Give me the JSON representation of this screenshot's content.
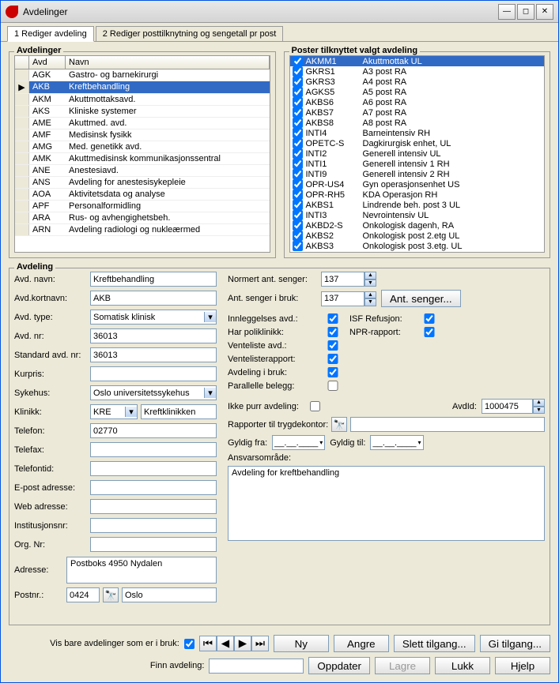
{
  "window": {
    "title": "Avdelinger"
  },
  "tabs": [
    {
      "label": "1 Rediger avdeling",
      "active": true
    },
    {
      "label": "2 Rediger posttilknytning og sengetall pr post",
      "active": false
    }
  ],
  "avdelinger": {
    "legend": "Avdelinger",
    "headers": {
      "avd": "Avd",
      "navn": "Navn"
    },
    "rows": [
      {
        "avd": "AGK",
        "navn": "Gastro- og barnekirurgi"
      },
      {
        "avd": "AKB",
        "navn": "Kreftbehandling",
        "selected": true,
        "current": true
      },
      {
        "avd": "AKM",
        "navn": "Akuttmottaksavd."
      },
      {
        "avd": "AKS",
        "navn": "Kliniske systemer"
      },
      {
        "avd": "AME",
        "navn": "Akuttmed. avd."
      },
      {
        "avd": "AMF",
        "navn": "Medisinsk fysikk"
      },
      {
        "avd": "AMG",
        "navn": "Med. genetikk avd."
      },
      {
        "avd": "AMK",
        "navn": "Akuttmedisinsk kommunikasjonssentral"
      },
      {
        "avd": "ANE",
        "navn": "Anestesiavd."
      },
      {
        "avd": "ANS",
        "navn": "Avdeling for anestesisykepleie"
      },
      {
        "avd": "AOA",
        "navn": "Aktivitetsdata og analyse"
      },
      {
        "avd": "APF",
        "navn": "Personalformidling"
      },
      {
        "avd": "ARA",
        "navn": "Rus- og avhengighetsbeh."
      },
      {
        "avd": "ARN",
        "navn": "Avdeling radiologi og nukleærmed"
      }
    ]
  },
  "poster": {
    "legend": "Poster tilknyttet valgt avdeling",
    "rows": [
      {
        "code": "AKMM1",
        "name": "Akuttmottak UL",
        "selected": true,
        "checked": true
      },
      {
        "code": "GKRS1",
        "name": "A3 post RA",
        "checked": true
      },
      {
        "code": "GKRS3",
        "name": "A4 post  RA",
        "checked": true
      },
      {
        "code": "AGKS5",
        "name": "A5 post RA",
        "checked": true
      },
      {
        "code": "AKBS6",
        "name": "A6 post RA",
        "checked": true
      },
      {
        "code": "AKBS7",
        "name": "A7 post  RA",
        "checked": true
      },
      {
        "code": "AKBS8",
        "name": "A8 post RA",
        "checked": true
      },
      {
        "code": "INTI4",
        "name": "Barneintensiv RH",
        "checked": true
      },
      {
        "code": "OPETC-S",
        "name": "Dagkirurgisk enhet, UL",
        "checked": true
      },
      {
        "code": "INTI2",
        "name": "Generell intensiv UL",
        "checked": true
      },
      {
        "code": "INTI1",
        "name": "Generell intensiv 1 RH",
        "checked": true
      },
      {
        "code": "INTI9",
        "name": "Generell intensiv 2 RH",
        "checked": true
      },
      {
        "code": "OPR-US4",
        "name": "Gyn operasjonsenhet US",
        "checked": true
      },
      {
        "code": "OPR-RH5",
        "name": "KDA Operasjon RH",
        "checked": true
      },
      {
        "code": "AKBS1",
        "name": "Lindrende beh. post 3 UL",
        "checked": true
      },
      {
        "code": "INTI3",
        "name": "Nevrointensiv UL",
        "checked": true
      },
      {
        "code": "AKBD2-S",
        "name": "Onkologisk dagenh, RA",
        "checked": true
      },
      {
        "code": "AKBS2",
        "name": "Onkologisk post 2.etg UL",
        "checked": true
      },
      {
        "code": "AKBS3",
        "name": "Onkologisk post 3.etg. UL",
        "checked": true
      }
    ]
  },
  "avdeling": {
    "legend": "Avdeling",
    "labels": {
      "navn": "Avd. navn:",
      "kortnavn": "Avd.kortnavn:",
      "type": "Avd. type:",
      "nr": "Avd. nr:",
      "stdnr": "Standard avd. nr:",
      "kurpris": "Kurpris:",
      "sykehus": "Sykehus:",
      "klinikk": "Klinikk:",
      "telefon": "Telefon:",
      "telefax": "Telefax:",
      "telefontid": "Telefontid:",
      "epost": "E-post adresse:",
      "web": "Web adresse:",
      "instnr": "Institusjonsnr:",
      "orgnr": "Org. Nr:",
      "adresse": "Adresse:",
      "postnr": "Postnr.:",
      "normert": "Normert ant. senger:",
      "ibruk": "Ant. senger i bruk:",
      "antsenger": "Ant. senger...",
      "innlegg": "Innleggelses avd.:",
      "poliklinikk": "Har poliklinikk:",
      "venteliste": "Venteliste avd.:",
      "ventelisterapport": "Ventelisterapport:",
      "avdibruk": "Avdeling i bruk:",
      "parallelle": "Parallelle belegg:",
      "isf": "ISF Refusjon:",
      "npr": "NPR-rapport:",
      "ikkepurr": "Ikke purr avdeling:",
      "avdid": "AvdId:",
      "rapporter": "Rapporter til trygdekontor:",
      "gyldigfra": "Gyldig fra:",
      "gyldigtil": "Gyldig til:",
      "ansvar": "Ansvarsområde:"
    },
    "values": {
      "navn": "Kreftbehandling",
      "kortnavn": "AKB",
      "type": "Somatisk klinisk",
      "nr": "36013",
      "stdnr": "36013",
      "kurpris": "",
      "sykehus": "Oslo universitetssykehus",
      "klinikk_code": "KRE",
      "klinikk_name": "Kreftklinikken",
      "telefon": "02770",
      "telefax": "",
      "telefontid": "",
      "epost": "",
      "web": "",
      "instnr": "",
      "orgnr": "",
      "adresse": "Postboks 4950 Nydalen",
      "postnr": "0424",
      "poststed": "Oslo",
      "normert": "137",
      "ibruk": "137",
      "innlegg": true,
      "poliklinikk": true,
      "venteliste": true,
      "ventelisterapport": true,
      "avdibruk": true,
      "parallelle": false,
      "isf": true,
      "npr": true,
      "ikkepurr": false,
      "avdid": "1000475",
      "rapport_kontor": "",
      "gyldigfra": "__.__.____",
      "gyldigtil": "__.__.____",
      "ansvar": "Avdeling for kreftbehandling"
    }
  },
  "footer": {
    "vis_bare": "Vis bare avdelinger som er i bruk:",
    "finn": "Finn avdeling:",
    "buttons": {
      "ny": "Ny",
      "angre": "Angre",
      "slett": "Slett tilgang...",
      "gi": "Gi tilgang...",
      "oppdater": "Oppdater",
      "lagre": "Lagre",
      "lukk": "Lukk",
      "hjelp": "Hjelp"
    }
  }
}
